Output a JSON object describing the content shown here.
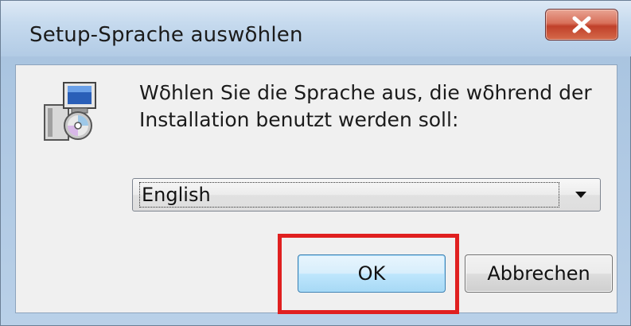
{
  "window": {
    "title": "Setup-Sprache auswδhlen",
    "close_icon": "close-x-icon"
  },
  "dialog": {
    "icon": "setup-installer-icon",
    "message": "Wδhlen Sie die Sprache aus, die wδhrend der Installation benutzt werden soll:",
    "language_select": {
      "selected": "English",
      "arrow_icon": "dropdown-arrow-icon"
    },
    "buttons": {
      "ok_label": "OK",
      "cancel_label": "Abbrechen"
    },
    "highlight_color": "#e02020"
  }
}
